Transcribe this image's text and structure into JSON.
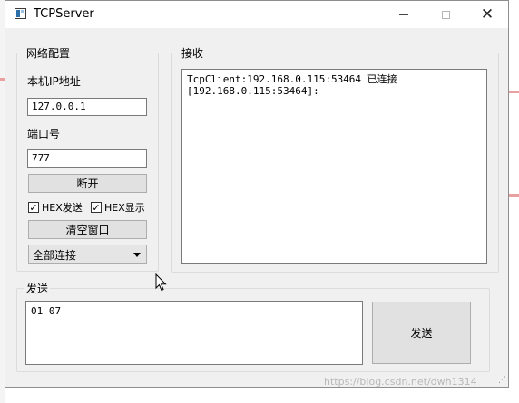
{
  "window": {
    "title": "TCPServer"
  },
  "network": {
    "group_title": "网络配置",
    "ip_label": "本机IP地址",
    "ip_value": "127.0.0.1",
    "port_label": "端口号",
    "port_value": "777",
    "disconnect_label": "断开",
    "hex_send_label": "HEX发送",
    "hex_send_checked": true,
    "hex_display_label": "HEX显示",
    "hex_display_checked": true,
    "clear_label": "清空窗口",
    "target_select": "全部连接"
  },
  "receive": {
    "group_title": "接收",
    "lines": "TcpClient:192.168.0.115:53464 已连接\n[192.168.0.115:53464]:"
  },
  "send": {
    "group_title": "发送",
    "text": "01 07",
    "send_label": "发送"
  },
  "watermark": "https://blog.csdn.net/dwh1314"
}
